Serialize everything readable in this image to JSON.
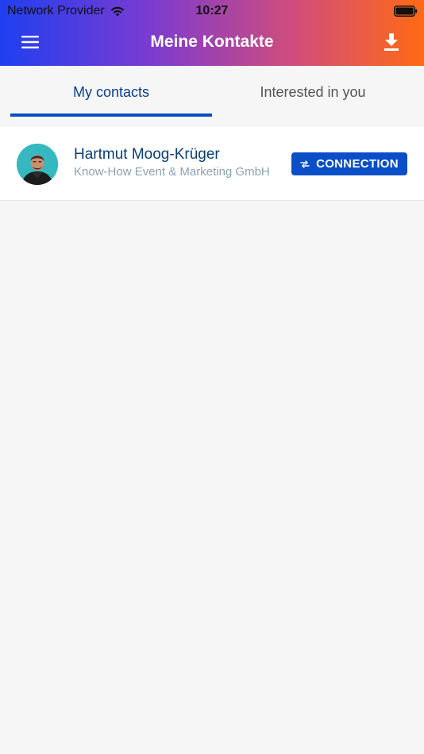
{
  "status_bar": {
    "carrier": "Network Provider",
    "time": "10:27",
    "wifi_icon": "wifi-icon",
    "battery_icon": "battery-icon"
  },
  "header": {
    "title": "Meine Kontakte",
    "menu_icon": "hamburger-menu-icon",
    "download_icon": "download-icon",
    "gradient_colors": [
      "#1f3ff0",
      "#7a3bd2",
      "#d34d7a",
      "#ff6a12"
    ]
  },
  "tabs": [
    {
      "label": "My contacts",
      "active": true
    },
    {
      "label": "Interested in you",
      "active": false
    }
  ],
  "contacts": [
    {
      "name": "Hartmut Moog-Krüger",
      "company": "Know-How Event & Marketing GmbH",
      "action_label": "CONNECTION",
      "action_icon": "swap-arrows-icon"
    }
  ],
  "colors": {
    "accent": "#0a4fc8",
    "name_text": "#0a3e77",
    "company_text": "#8da1b4",
    "avatar_background": "#35b8c0"
  }
}
